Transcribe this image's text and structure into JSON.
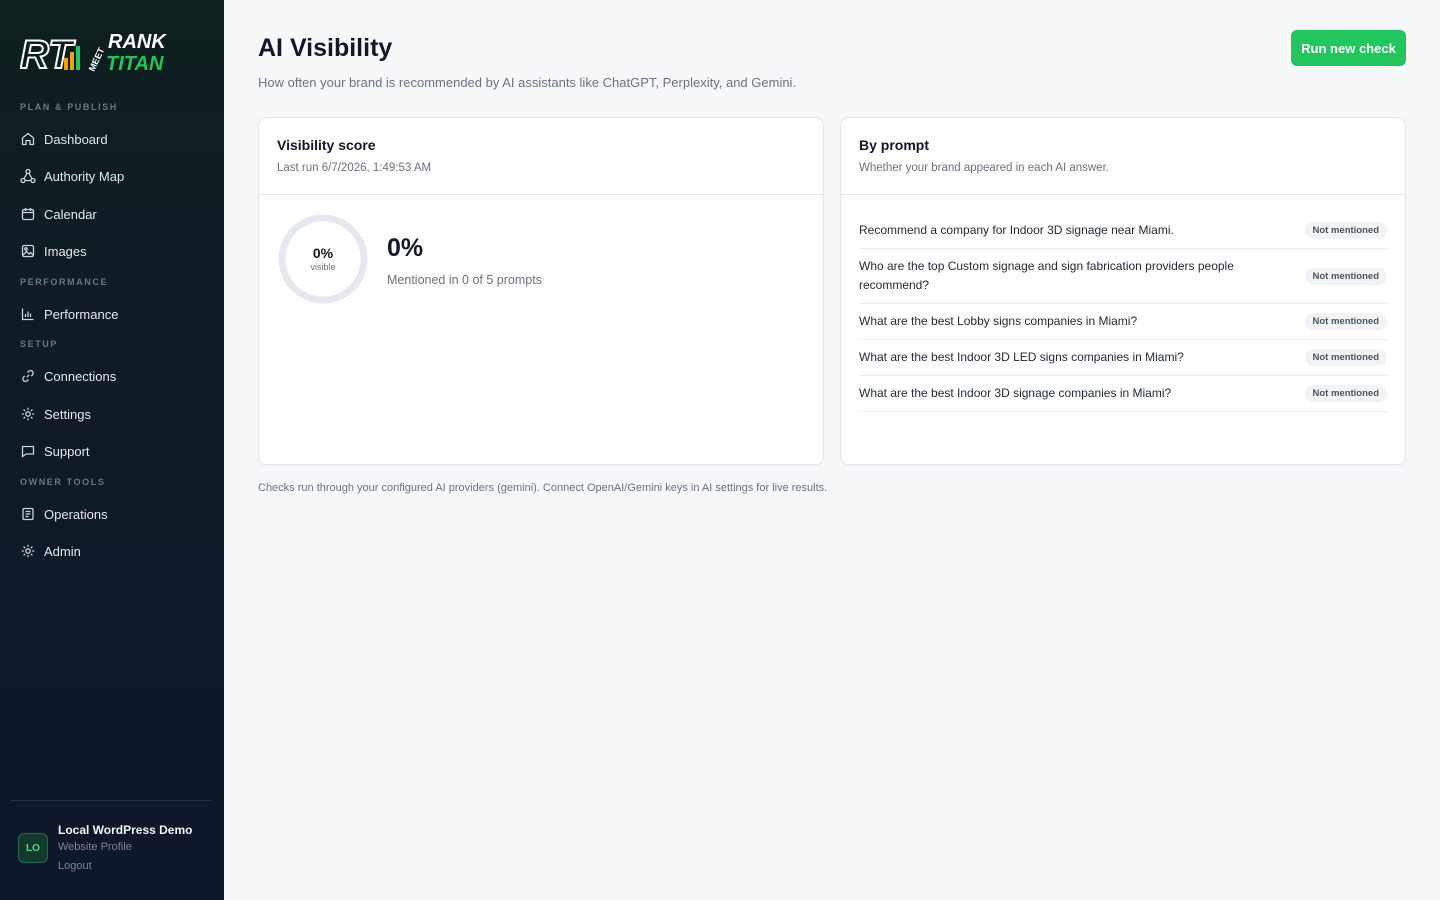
{
  "brand": {
    "logo_primary": "RANK",
    "logo_secondary": "TITAN",
    "logo_meet": "MEET",
    "logo_mark": "RT"
  },
  "sidebar": {
    "sections": [
      {
        "label": "PLAN & PUBLISH"
      },
      {
        "label": "PERFORMANCE"
      },
      {
        "label": "SETUP"
      },
      {
        "label": "OWNER TOOLS"
      }
    ],
    "items": [
      {
        "label": "Dashboard",
        "icon": "home-icon"
      },
      {
        "label": "Authority Map",
        "icon": "network-icon"
      },
      {
        "label": "Calendar",
        "icon": "calendar-icon"
      },
      {
        "label": "Images",
        "icon": "image-icon"
      },
      {
        "label": "Performance",
        "icon": "bar-chart-icon"
      },
      {
        "label": "Connections",
        "icon": "link-icon"
      },
      {
        "label": "Settings",
        "icon": "gear-icon"
      },
      {
        "label": "Support",
        "icon": "chat-icon"
      },
      {
        "label": "Operations",
        "icon": "document-icon"
      },
      {
        "label": "Admin",
        "icon": "gear-icon"
      }
    ],
    "profile": {
      "initials": "LO",
      "name": "Local WordPress Demo",
      "link1": "Website Profile",
      "link2": "Logout"
    }
  },
  "header": {
    "title": "AI Visibility",
    "subtitle": "How often your brand is recommended by AI assistants like ChatGPT, Perplexity, and Gemini.",
    "run_button": "Run new check"
  },
  "score_card": {
    "title": "Visibility score",
    "last_run": "Last run 6/7/2026, 1:49:53 AM",
    "ring_pct": "0%",
    "ring_label": "visible",
    "big_pct": "0%",
    "mentioned": "Mentioned in 0 of 5 prompts",
    "visible_fraction": 0
  },
  "prompt_card": {
    "title": "By prompt",
    "subtitle": "Whether your brand appeared in each AI answer.",
    "rows": [
      {
        "text": "Recommend a company for Indoor 3D signage near Miami.",
        "status": "Not mentioned"
      },
      {
        "text": "Who are the top Custom signage and sign fabrication providers people recommend?",
        "status": "Not mentioned"
      },
      {
        "text": "What are the best Lobby signs companies in Miami?",
        "status": "Not mentioned"
      },
      {
        "text": "What are the best Indoor 3D LED signs companies in Miami?",
        "status": "Not mentioned"
      },
      {
        "text": "What are the best Indoor 3D signage companies in Miami?",
        "status": "Not mentioned"
      }
    ]
  },
  "footnote": "Checks run through your configured AI providers (gemini). Connect OpenAI/Gemini keys in AI settings for live results.",
  "colors": {
    "accent": "#22c55e",
    "sidebar_bg": "#0f172a",
    "logo_orange": "#f59e0b",
    "logo_green": "#22c55e"
  }
}
